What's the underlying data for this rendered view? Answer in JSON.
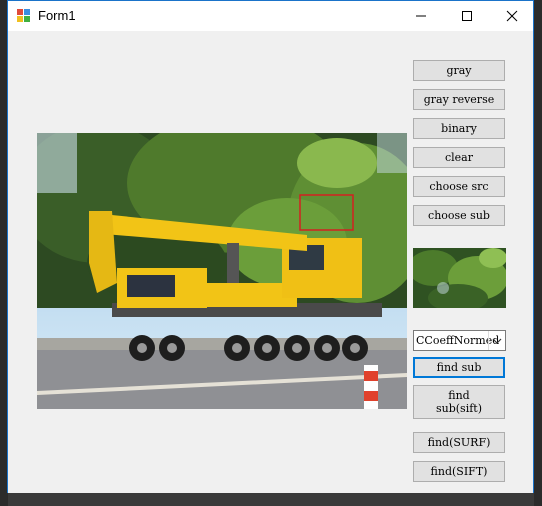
{
  "window": {
    "title": "Form1"
  },
  "titlebar_buttons": [
    "minimize",
    "maximize",
    "close"
  ],
  "buttons": {
    "gray": "gray",
    "gray_reverse": "gray reverse",
    "binary": "binary",
    "clear": "clear",
    "choose_src": "choose src",
    "choose_sub": "choose sub",
    "find_sub": "find sub",
    "find_sub_sift_line1": "find",
    "find_sub_sift_line2": "sub(sift)",
    "find_surf": "find(SURF)",
    "find_sift": "find(SIFT)"
  },
  "match_method": {
    "selected": "CCoeffNormed"
  },
  "colors": {
    "accent": "#0078d7",
    "window_border": "#1a73c9",
    "match_rect": "#d32020"
  }
}
